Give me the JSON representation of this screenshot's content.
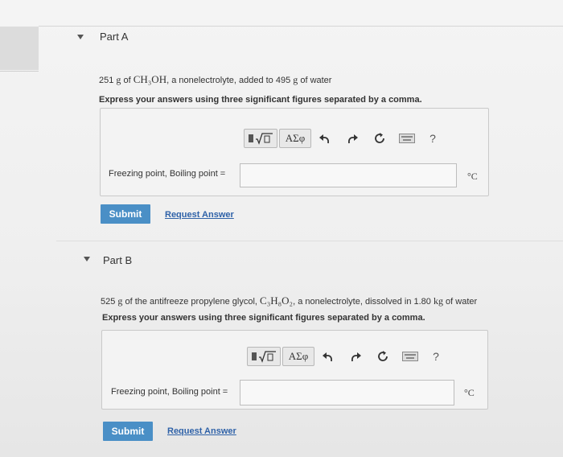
{
  "parts": [
    {
      "title": "Part A",
      "question": {
        "mass_text": "251",
        "mass_unit": "g",
        "mid1": " of ",
        "formula": "CH₃OH",
        "mid2": ", a nonelectrolyte, added to ",
        "mass2": "495",
        "mass2_unit": "g",
        "end": " of water"
      },
      "instruction": "Express your answers using three significant figures separated by a comma.",
      "toolbar": {
        "greek": "ΑΣφ",
        "help": "?"
      },
      "field_label": "Freezing point, Boiling point =",
      "field_value": "",
      "unit": "°C",
      "submit": "Submit",
      "request": "Request Answer"
    },
    {
      "title": "Part B",
      "question": {
        "mass_text": "525",
        "mass_unit": "g",
        "mid1": " of the antifreeze propylene glycol, ",
        "formula": "C₃H₈O₂",
        "mid2": ", a nonelectrolyte, dissolved in ",
        "mass2": "1.80",
        "mass2_unit": "kg",
        "end": " of water"
      },
      "instruction": "Express your answers using three significant figures separated by a comma.",
      "toolbar": {
        "greek": "ΑΣφ",
        "help": "?"
      },
      "field_label": "Freezing point, Boiling point =",
      "field_value": "",
      "unit": "°C",
      "submit": "Submit",
      "request": "Request Answer"
    }
  ]
}
